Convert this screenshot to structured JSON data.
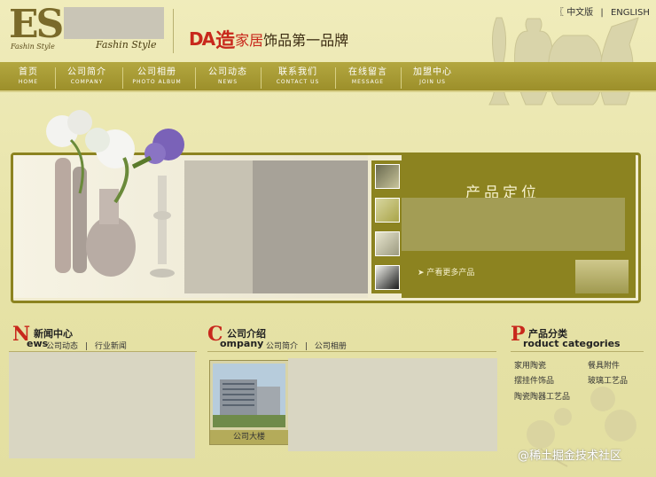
{
  "header": {
    "logo_text": "ES",
    "logo_sub": "Fashin Style",
    "logo_script": "Fashin Style",
    "slogan_mark": "DA",
    "slogan_part1": "造",
    "slogan_part2": "家居",
    "slogan_part3": "饰品第一品牌",
    "lang_cn": "中文版",
    "lang_sep": "|",
    "lang_en": "ENGLISH"
  },
  "nav": [
    {
      "cn": "首页",
      "en": "HOME"
    },
    {
      "cn": "公司简介",
      "en": "COMPANY"
    },
    {
      "cn": "公司相册",
      "en": "PHOTO ALBUM"
    },
    {
      "cn": "公司动态",
      "en": "NEWS"
    },
    {
      "cn": "联系我们",
      "en": "CONTACT US"
    },
    {
      "cn": "在线留言",
      "en": "MESSAGE"
    },
    {
      "cn": "加盟中心",
      "en": "JOIN US"
    }
  ],
  "banner": {
    "product_title": "产品定位",
    "more_link": "➤ 产看更多产品"
  },
  "news": {
    "big": "N",
    "title_cn": "新闻中心",
    "title_en": "ews",
    "link1": "公司动态",
    "sep": "|",
    "link2": "行业新闻"
  },
  "company": {
    "big": "C",
    "title_cn": "公司介绍",
    "title_en": "ompany",
    "link1": "公司简介",
    "sep": "|",
    "link2": "公司相册",
    "photo_caption": "公司大楼"
  },
  "products": {
    "big": "P",
    "title_cn": "产品分类",
    "title_en": "roduct categories",
    "items": [
      "家用陶瓷",
      "餐具附件",
      "摆挂件饰品",
      "玻璃工艺品",
      "陶瓷陶器工艺品"
    ]
  },
  "watermark": "@稀土掘金技术社区",
  "colors": {
    "nav_bg": "#9c8f2a",
    "accent_red": "#c8281c",
    "panel_olive": "#8c8320",
    "page_bg": "#e9e4a8"
  }
}
